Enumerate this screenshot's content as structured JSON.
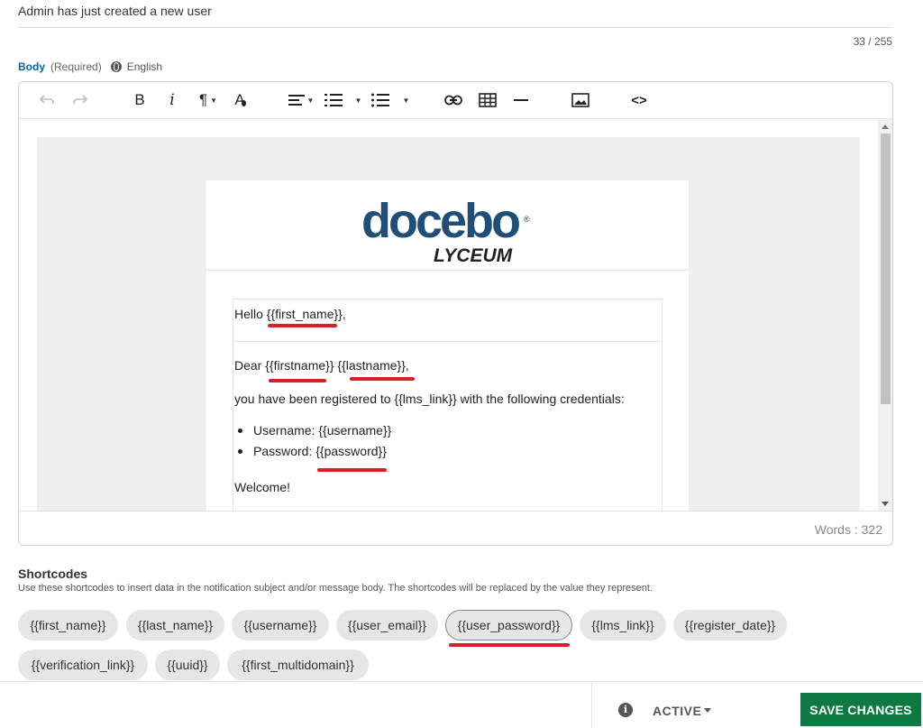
{
  "subject": {
    "value": "Admin has just created a new user",
    "char_count": "33 / 255"
  },
  "body_section": {
    "label": "Body",
    "required": "(Required)",
    "language": "English"
  },
  "toolbar": {
    "bold": "B",
    "italic": "i",
    "paragraph": "¶",
    "text_color": "A",
    "code": "<>"
  },
  "email": {
    "logo_main": "docebo",
    "logo_reg": "®",
    "logo_sub": "LYCEUM",
    "hello": "Hello {{first_name}},",
    "dear": "Dear {{firstname}} {{lastname}},",
    "registered": "you have been registered to {{lms_link}} with the following credentials:",
    "bullets": [
      "Username: {{username}}",
      "Password: {{password}}"
    ],
    "welcome": "Welcome!"
  },
  "words": "Words : 322",
  "shortcodes": {
    "title": "Shortcodes",
    "description": "Use these shortcodes to insert data in the notification subject and/or message body. The shortcodes will be replaced by the value they represent.",
    "items": [
      "{{first_name}}",
      "{{last_name}}",
      "{{username}}",
      "{{user_email}}",
      "{{user_password}}",
      "{{lms_link}}",
      "{{register_date}}",
      "{{verification_link}}",
      "{{uuid}}",
      "{{first_multidomain}}"
    ]
  },
  "footer": {
    "status": "ACTIVE",
    "save_label": "SAVE CHANGES",
    "info_icon": "i"
  },
  "colors": {
    "accent_blue": "#0465ac",
    "save_green": "#0e7a43",
    "annotation_red": "#d81f2a",
    "logo_blue": "#1f4e79"
  },
  "icons": [
    "undo-icon",
    "redo-icon",
    "bold-icon",
    "italic-icon",
    "paragraph-icon",
    "text-color-icon",
    "align-icon",
    "numbered-list-icon",
    "bullet-list-icon",
    "link-icon",
    "table-icon",
    "horizontal-rule-icon",
    "image-icon",
    "code-icon",
    "globe-icon",
    "info-icon"
  ]
}
